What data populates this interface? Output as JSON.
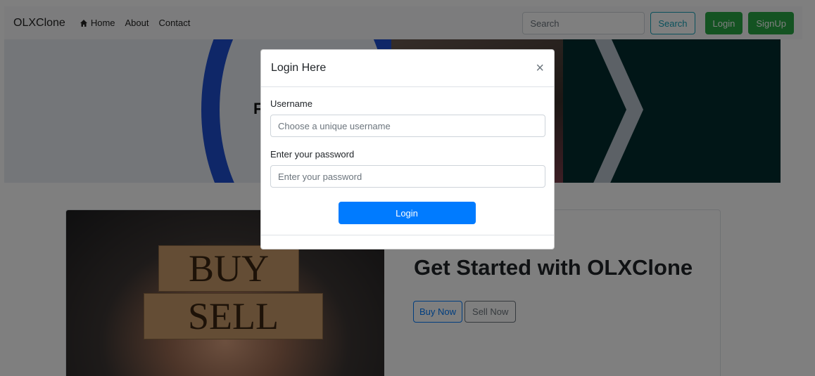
{
  "navbar": {
    "brand": "OLXClone",
    "links": [
      {
        "label": "Home",
        "icon": "home-icon"
      },
      {
        "label": "About"
      },
      {
        "label": "Contact"
      }
    ],
    "search_placeholder": "Search",
    "search_button": "Search",
    "login_button": "Login",
    "signup_button": "SignUp"
  },
  "hero": {
    "partial_text": "F"
  },
  "card": {
    "image_words": [
      "BUY",
      "SELL"
    ],
    "title": "Get Started with OLXClone",
    "buy_button": "Buy Now",
    "sell_button": "Sell Now"
  },
  "modal": {
    "title": "Login Here",
    "close_symbol": "×",
    "username_label": "Username",
    "username_placeholder": "Choose a unique username",
    "password_label": "Enter your password",
    "password_placeholder": "Enter your password",
    "submit_label": "Login"
  },
  "colors": {
    "primary": "#007bff",
    "success": "#28a745",
    "info": "#17a2b8",
    "secondary": "#6c757d",
    "navbar_bg": "#f8f9fa"
  }
}
